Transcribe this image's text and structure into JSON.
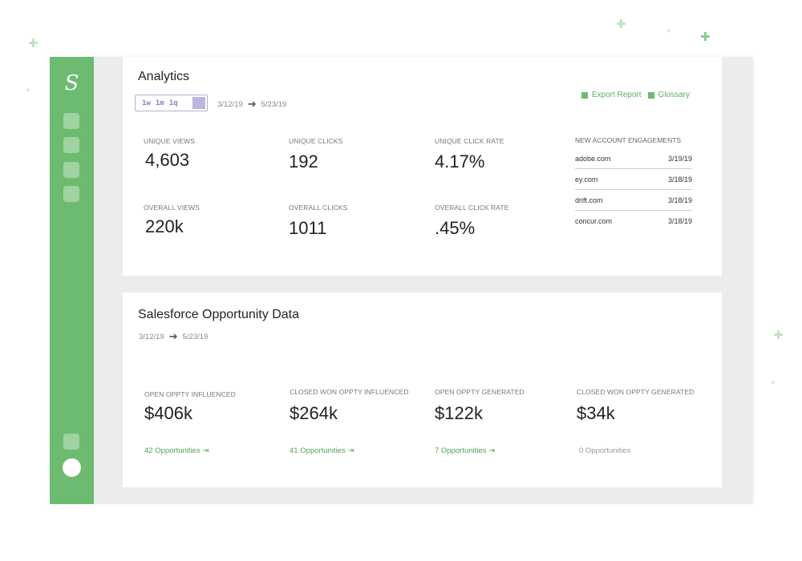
{
  "colors": {
    "brand": "#6dbb70",
    "accent_purple": "#8a80c0",
    "link_green": "#4fa652"
  },
  "decorations": {
    "plus": "✚"
  },
  "sidebar": {
    "logo": "S",
    "icons": [
      "nav-icon",
      "nav-icon",
      "nav-icon",
      "nav-icon",
      "settings-icon",
      "avatar"
    ]
  },
  "analytics": {
    "title": "Analytics",
    "range_options": [
      "1w",
      "1m",
      "1q"
    ],
    "date_from": "3/12/19",
    "arrow": "➔",
    "date_to": "5/23/19",
    "export_label": "Export Report",
    "glossary_label": "Glossary",
    "metrics": {
      "unique_views": {
        "label": "Unique Views",
        "value": "4,603"
      },
      "unique_clicks": {
        "label": "Unique Clicks",
        "value": "192"
      },
      "unique_click_rate": {
        "label": "Unique Click Rate",
        "value": "4.17%"
      },
      "overall_views": {
        "label": "Overall Views",
        "value": "220k"
      },
      "overall_clicks": {
        "label": "Overall Clicks",
        "value": "1011"
      },
      "overall_click_rate": {
        "label": "Overall Click Rate",
        "value": ".45%"
      }
    },
    "engagements": {
      "title": "New Account Engagements",
      "rows": [
        {
          "domain": "adobe.com",
          "date": "3/19/19"
        },
        {
          "domain": "ey.com",
          "date": "3/18/19"
        },
        {
          "domain": "drift.com",
          "date": "3/18/19"
        },
        {
          "domain": "concur.com",
          "date": "3/18/19"
        }
      ]
    }
  },
  "salesforce": {
    "title": "Salesforce Opportunity Data",
    "date_from": "3/12/19",
    "arrow": "➔",
    "date_to": "5/23/19",
    "metrics": [
      {
        "label": "Open Oppty Influenced",
        "value": "$406k",
        "opps": "42 Opportunities",
        "arrow": "⇥"
      },
      {
        "label": "Closed Won Oppty Influenced",
        "value": "$264k",
        "opps": "41 Opportunities",
        "arrow": "⇥"
      },
      {
        "label": "Open Oppty Generated",
        "value": "$122k",
        "opps": "7 Opportunities",
        "arrow": "⇥"
      },
      {
        "label": "Closed Won Oppty Generated",
        "value": "$34k",
        "opps": "0 Opportunities",
        "arrow": ""
      }
    ]
  }
}
